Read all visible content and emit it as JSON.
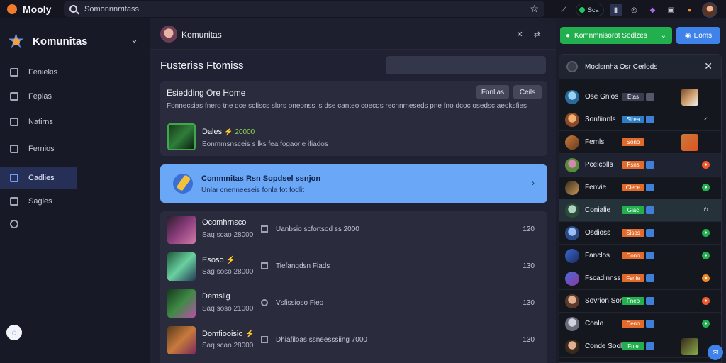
{
  "topbar": {
    "app_name": "Mooly",
    "search_placeholder": "Somonnnrritass",
    "status_label": "Sca"
  },
  "sidebar": {
    "title": "Komunitas",
    "items": [
      {
        "label": "Feniekis",
        "icon": "grid-icon"
      },
      {
        "label": "Feplas",
        "icon": "bookmark-icon"
      },
      {
        "label": "Natirns",
        "icon": "shield-icon"
      },
      {
        "label": "Fernios",
        "icon": "briefcase-icon"
      },
      {
        "label": "Cadlies",
        "icon": "users-icon"
      },
      {
        "label": "Sagies",
        "icon": "chart-icon"
      }
    ]
  },
  "main": {
    "community_name": "Komunitas",
    "top_actions": "✕ ⇄",
    "heading": "Fusteriss Ftomiss",
    "featured": {
      "title": "Esiedding Ore Home",
      "btn_1": "Fonlias",
      "btn_2": "Ceils",
      "description": "Fonnecsias fnero tne dce scfiscs slors oneonss is dse canteo coecds recnnmeseds pne fno dcoc osedsc aeoksfies",
      "game_name": "Dales",
      "game_tag": "⚡ 20000",
      "game_sub": "Eonmmsnsceis s lks fea fogaorie ifiados"
    },
    "promo": {
      "title": "Commnitas Rsn Sopdsel ssnjon",
      "subtitle": "Unlar cnenneeseis fonla fot fodlit"
    },
    "rows": [
      {
        "name": "Ocomhrnsco",
        "sub": "Saq scao 28000",
        "desc": "Uanbsio scfortsod ss 2000",
        "count": "120"
      },
      {
        "name": "Esoso ⚡",
        "sub": "Sag soso 28000",
        "desc": "Tiefangdsn Fiads",
        "count": "130"
      },
      {
        "name": "Demsiig",
        "sub": "Saq soso 21000",
        "desc": "Vsfissioso Fieo",
        "count": "130"
      },
      {
        "name": "Domfiooisio ⚡",
        "sub": "Saq scao 28000",
        "desc": "Dhiafiloas ssneesssiing 7000",
        "count": "130"
      }
    ]
  },
  "right": {
    "green_button": "Komnmnisorot Sodlzes",
    "blue_button": "Eoms",
    "panel_title": "Moclsrnha Osr Cerlods",
    "people": [
      {
        "name": "Ose Gnlos",
        "badge": "Etas"
      },
      {
        "name": "Sonfiinnls",
        "badge": "Sirea"
      },
      {
        "name": "Femls",
        "badge": "Sono"
      },
      {
        "name": "Pcelcolls",
        "badge": "Fsns"
      },
      {
        "name": "Fenvie",
        "badge": "Ciece"
      },
      {
        "name": "Conialie",
        "badge": "Giac"
      },
      {
        "name": "Osdioss",
        "badge": "Sisos"
      },
      {
        "name": "Fanclos",
        "badge": "Cono"
      },
      {
        "name": "Fscadinnss",
        "badge": "Fsnie"
      },
      {
        "name": "Sovrion Soraiaeiis",
        "badge": "Fneo"
      },
      {
        "name": "Conlo",
        "badge": "Ceno"
      },
      {
        "name": "Conde Soola",
        "badge": "Fnie"
      }
    ]
  },
  "colors": {
    "accent": "#6aa7f7",
    "green": "#22b04e",
    "blue": "#3f83ea",
    "orange": "#f05a2b"
  }
}
